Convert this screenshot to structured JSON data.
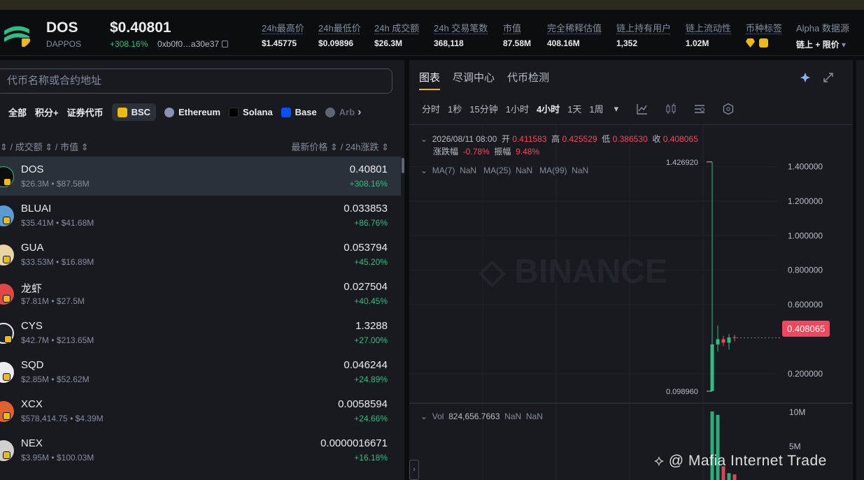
{
  "token": {
    "symbol": "DOS",
    "name": "DAPPOS",
    "price": "$0.40801",
    "change": "+308.16%",
    "address": "0xb0f0…a30e37"
  },
  "stats": [
    {
      "label": "24h最高价",
      "value": "$1.45775"
    },
    {
      "label": "24h最低价",
      "value": "$0.09896"
    },
    {
      "label": "24h 成交额",
      "value": "$26.3M"
    },
    {
      "label": "24h 交易笔数",
      "value": "368,118"
    },
    {
      "label": "市值",
      "value": "87.58M"
    },
    {
      "label": "完全稀释估值",
      "value": "408.16M"
    },
    {
      "label": "链上持有用户",
      "value": "1,352"
    },
    {
      "label": "链上流动性",
      "value": "1.02M"
    },
    {
      "label": "币种标签",
      "value": ""
    },
    {
      "label": "Alpha 数据源",
      "value": "链上 + 限价"
    }
  ],
  "search": {
    "placeholder": "代币名称或合约地址"
  },
  "filters": [
    "全部",
    "积分+",
    "证券代币",
    "BSC",
    "Ethereum",
    "Solana",
    "Base",
    "Arb"
  ],
  "sort": {
    "left": "/ 成交额",
    "left2": "/ 市值",
    "right": "最新价格",
    "right2": "/ 24h涨跌"
  },
  "tokens": [
    {
      "name": "DOS",
      "sub": "$26.3M • $87.58M",
      "price": "0.40801",
      "change": "+308.16%",
      "color": "#2ebd85"
    },
    {
      "name": "BLUAI",
      "sub": "$35.41M • $41.68M",
      "price": "0.033853",
      "change": "+86.76%",
      "color": "#5b9bd5"
    },
    {
      "name": "GUA",
      "sub": "$33.53M • $16.89M",
      "price": "0.053794",
      "change": "+45.20%",
      "color": "#e8d5a3"
    },
    {
      "name": "龙虾",
      "sub": "$7.81M • $27.5M",
      "price": "0.027504",
      "change": "+40.45%",
      "color": "#e04848"
    },
    {
      "name": "CYS",
      "sub": "$42.7M • $213.65M",
      "price": "1.3288",
      "change": "+27.00%",
      "color": "#1e2329"
    },
    {
      "name": "SQD",
      "sub": "$2.85M • $52.62M",
      "price": "0.046244",
      "change": "+24.89%",
      "color": "#eaecef"
    },
    {
      "name": "XCX",
      "sub": "$578,414.75 • $4.39M",
      "price": "0.0058594",
      "change": "+24.66%",
      "color": "#e06030"
    },
    {
      "name": "NEX",
      "sub": "$3.95M • $100.03M",
      "price": "0.0000016671",
      "change": "+16.18%",
      "color": "#d0d0d0"
    }
  ],
  "tabs": [
    "图表",
    "尽调中心",
    "代币检测"
  ],
  "intervals": [
    "分时",
    "1秒",
    "15分钟",
    "1小时",
    "4小时",
    "1天",
    "1周"
  ],
  "ohlc": {
    "date": "2026/08/11 08:00",
    "open_label": "开",
    "open": "0.411583",
    "high_label": "高",
    "high": "0.425529",
    "low_label": "低",
    "low": "0.386530",
    "close_label": "收",
    "close": "0.408065",
    "chg_label": "涨跌幅",
    "chg": "-0.78%",
    "amp_label": "振幅",
    "amp": "9.48%"
  },
  "ma": {
    "ma7": "MA(7)",
    "ma25": "MA(25)",
    "ma99": "MA(99)",
    "nan": "NaN"
  },
  "vol": {
    "label": "Vol",
    "value": "824,656.7663",
    "nan": "NaN"
  },
  "chart_data": {
    "type": "candlestick",
    "y_ticks": [
      "1.400000",
      "1.200000",
      "1.000000",
      "0.800000",
      "0.600000",
      "0.200000"
    ],
    "y_tick_values": [
      1.4,
      1.2,
      1.0,
      0.8,
      0.6,
      0.2
    ],
    "ylim": [
      0.05,
      1.6
    ],
    "high_marker": "1.426920",
    "low_marker": "0.098960",
    "last_price": "0.408065",
    "candles": [
      {
        "o": 0.1,
        "h": 1.42692,
        "l": 0.09896,
        "c": 0.37,
        "up": true
      },
      {
        "o": 0.37,
        "h": 0.48,
        "l": 0.33,
        "c": 0.4,
        "up": true
      },
      {
        "o": 0.4,
        "h": 0.42,
        "l": 0.36,
        "c": 0.38,
        "up": false
      },
      {
        "o": 0.38,
        "h": 0.43,
        "l": 0.34,
        "c": 0.41,
        "up": true
      },
      {
        "o": 0.411583,
        "h": 0.425529,
        "l": 0.38653,
        "c": 0.408065,
        "up": false
      }
    ],
    "vol_ticks": [
      "10M",
      "5M"
    ],
    "vol_tick_values": [
      10,
      5
    ],
    "volumes": [
      10,
      9.5,
      2,
      1,
      0.82
    ],
    "watermark": "BINANCE"
  },
  "footer_watermark": "@ Mafia Internet Trade",
  "colors": {
    "up": "#2ebd85",
    "down": "#f6465d",
    "accent": "#f0b90b"
  }
}
